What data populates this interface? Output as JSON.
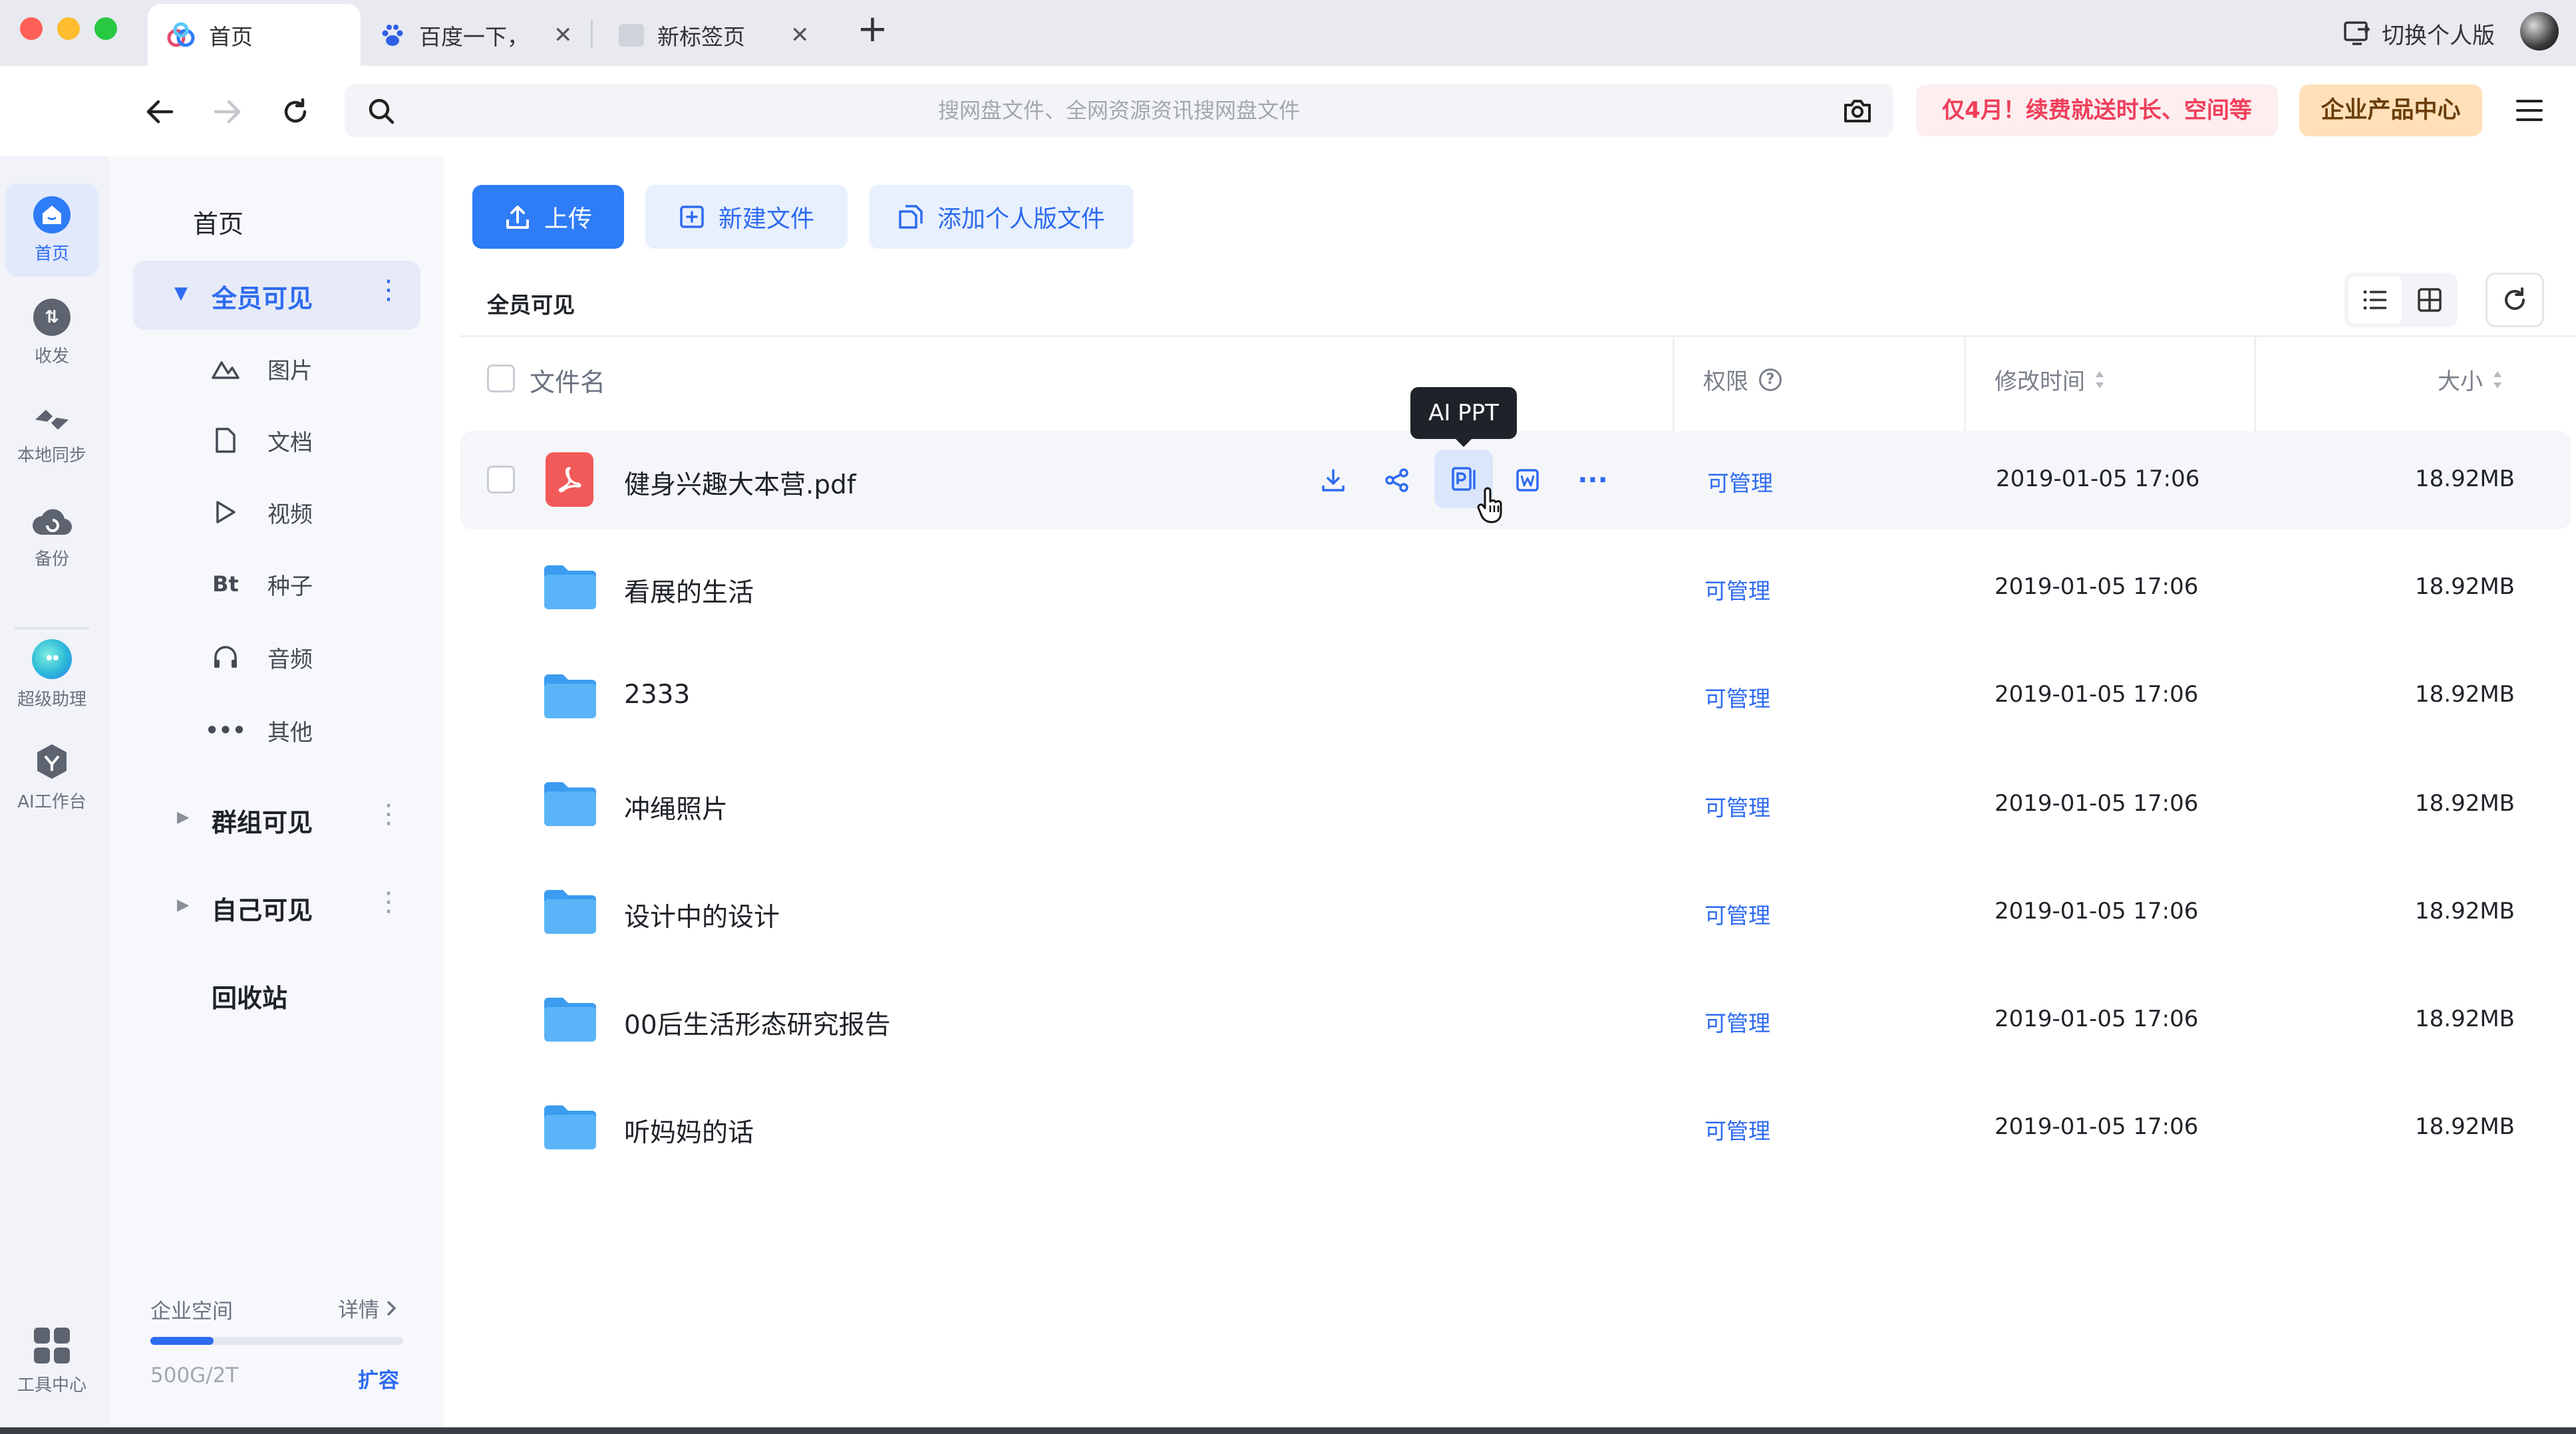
{
  "tabs": [
    {
      "label": "首页",
      "active": true
    },
    {
      "label": "百度一下，",
      "active": false
    },
    {
      "label": "新标签页",
      "active": false
    }
  ],
  "switch_label": "切换个人版",
  "search": {
    "placeholder": "搜网盘文件、全网资源资讯搜网盘文件"
  },
  "promo_label": "仅4月！续费就送时长、空间等",
  "enterprise_label": "企业产品中心",
  "rail": [
    {
      "label": "首页",
      "icon": "home-icon",
      "active": true
    },
    {
      "label": "收发",
      "icon": "transfer-icon",
      "active": false
    },
    {
      "label": "本地同步",
      "icon": "sync-icon",
      "active": false
    },
    {
      "label": "备份",
      "icon": "backup-icon",
      "active": false
    },
    {
      "label": "超级助理",
      "icon": "assistant-icon",
      "active": false
    },
    {
      "label": "AI工作台",
      "icon": "ai-workbench-icon",
      "active": false
    }
  ],
  "rail_tools_label": "工具中心",
  "sidenav": {
    "title": "首页",
    "visible_all": "全员可见",
    "sub_items": [
      {
        "label": "图片",
        "icon": "image-icon"
      },
      {
        "label": "文档",
        "icon": "document-icon"
      },
      {
        "label": "视频",
        "icon": "video-icon"
      },
      {
        "label": "种子",
        "icon": "torrent-icon",
        "glyph": "Bt"
      },
      {
        "label": "音频",
        "icon": "audio-icon"
      },
      {
        "label": "其他",
        "icon": "more-icon"
      }
    ],
    "group_visible": "群组可见",
    "self_visible": "自己可见",
    "recycle": "回收站"
  },
  "storage": {
    "label": "企业空间",
    "details": "详情",
    "usage": "500G/2T",
    "used_fraction": 0.25,
    "expand": "扩容"
  },
  "actions": {
    "upload": "上传",
    "new_file": "新建文件",
    "add_personal": "添加个人版文件"
  },
  "breadcrumb": "全员可见",
  "columns": {
    "name": "文件名",
    "permission": "权限",
    "modified": "修改时间",
    "size": "大小"
  },
  "tooltip": "AI PPT",
  "files": [
    {
      "name": "健身兴趣大本营.pdf",
      "type": "pdf",
      "permission": "可管理",
      "modified": "2019-01-05 17:06",
      "size": "18.92MB",
      "hovered": true
    },
    {
      "name": "看展的生活",
      "type": "folder",
      "permission": "可管理",
      "modified": "2019-01-05 17:06",
      "size": "18.92MB"
    },
    {
      "name": "2333",
      "type": "folder",
      "permission": "可管理",
      "modified": "2019-01-05 17:06",
      "size": "18.92MB"
    },
    {
      "name": "冲绳照片",
      "type": "folder",
      "permission": "可管理",
      "modified": "2019-01-05 17:06",
      "size": "18.92MB"
    },
    {
      "name": "设计中的设计",
      "type": "folder",
      "permission": "可管理",
      "modified": "2019-01-05 17:06",
      "size": "18.92MB"
    },
    {
      "name": "00后生活形态研究报告",
      "type": "folder",
      "permission": "可管理",
      "modified": "2019-01-05 17:06",
      "size": "18.92MB"
    },
    {
      "name": "听妈妈的话",
      "type": "folder",
      "permission": "可管理",
      "modified": "2019-01-05 17:06",
      "size": "18.92MB"
    }
  ],
  "colors": {
    "accent": "#2e7cf6",
    "link": "#2e6bf0",
    "promo": "#f03e5a",
    "folder": "#4aa8f4"
  }
}
